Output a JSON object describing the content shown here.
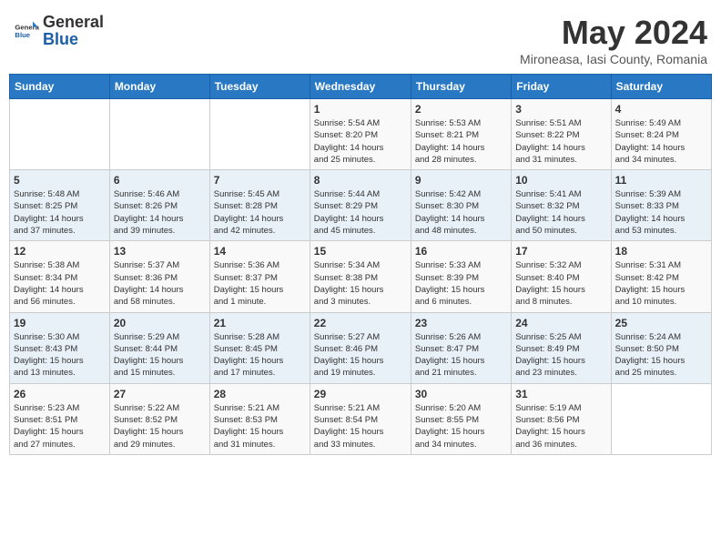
{
  "header": {
    "logo_general": "General",
    "logo_blue": "Blue",
    "month_title": "May 2024",
    "location": "Mironeasa, Iasi County, Romania"
  },
  "days_of_week": [
    "Sunday",
    "Monday",
    "Tuesday",
    "Wednesday",
    "Thursday",
    "Friday",
    "Saturday"
  ],
  "weeks": [
    [
      {
        "day": "",
        "info": ""
      },
      {
        "day": "",
        "info": ""
      },
      {
        "day": "",
        "info": ""
      },
      {
        "day": "1",
        "info": "Sunrise: 5:54 AM\nSunset: 8:20 PM\nDaylight: 14 hours\nand 25 minutes."
      },
      {
        "day": "2",
        "info": "Sunrise: 5:53 AM\nSunset: 8:21 PM\nDaylight: 14 hours\nand 28 minutes."
      },
      {
        "day": "3",
        "info": "Sunrise: 5:51 AM\nSunset: 8:22 PM\nDaylight: 14 hours\nand 31 minutes."
      },
      {
        "day": "4",
        "info": "Sunrise: 5:49 AM\nSunset: 8:24 PM\nDaylight: 14 hours\nand 34 minutes."
      }
    ],
    [
      {
        "day": "5",
        "info": "Sunrise: 5:48 AM\nSunset: 8:25 PM\nDaylight: 14 hours\nand 37 minutes."
      },
      {
        "day": "6",
        "info": "Sunrise: 5:46 AM\nSunset: 8:26 PM\nDaylight: 14 hours\nand 39 minutes."
      },
      {
        "day": "7",
        "info": "Sunrise: 5:45 AM\nSunset: 8:28 PM\nDaylight: 14 hours\nand 42 minutes."
      },
      {
        "day": "8",
        "info": "Sunrise: 5:44 AM\nSunset: 8:29 PM\nDaylight: 14 hours\nand 45 minutes."
      },
      {
        "day": "9",
        "info": "Sunrise: 5:42 AM\nSunset: 8:30 PM\nDaylight: 14 hours\nand 48 minutes."
      },
      {
        "day": "10",
        "info": "Sunrise: 5:41 AM\nSunset: 8:32 PM\nDaylight: 14 hours\nand 50 minutes."
      },
      {
        "day": "11",
        "info": "Sunrise: 5:39 AM\nSunset: 8:33 PM\nDaylight: 14 hours\nand 53 minutes."
      }
    ],
    [
      {
        "day": "12",
        "info": "Sunrise: 5:38 AM\nSunset: 8:34 PM\nDaylight: 14 hours\nand 56 minutes."
      },
      {
        "day": "13",
        "info": "Sunrise: 5:37 AM\nSunset: 8:36 PM\nDaylight: 14 hours\nand 58 minutes."
      },
      {
        "day": "14",
        "info": "Sunrise: 5:36 AM\nSunset: 8:37 PM\nDaylight: 15 hours\nand 1 minute."
      },
      {
        "day": "15",
        "info": "Sunrise: 5:34 AM\nSunset: 8:38 PM\nDaylight: 15 hours\nand 3 minutes."
      },
      {
        "day": "16",
        "info": "Sunrise: 5:33 AM\nSunset: 8:39 PM\nDaylight: 15 hours\nand 6 minutes."
      },
      {
        "day": "17",
        "info": "Sunrise: 5:32 AM\nSunset: 8:40 PM\nDaylight: 15 hours\nand 8 minutes."
      },
      {
        "day": "18",
        "info": "Sunrise: 5:31 AM\nSunset: 8:42 PM\nDaylight: 15 hours\nand 10 minutes."
      }
    ],
    [
      {
        "day": "19",
        "info": "Sunrise: 5:30 AM\nSunset: 8:43 PM\nDaylight: 15 hours\nand 13 minutes."
      },
      {
        "day": "20",
        "info": "Sunrise: 5:29 AM\nSunset: 8:44 PM\nDaylight: 15 hours\nand 15 minutes."
      },
      {
        "day": "21",
        "info": "Sunrise: 5:28 AM\nSunset: 8:45 PM\nDaylight: 15 hours\nand 17 minutes."
      },
      {
        "day": "22",
        "info": "Sunrise: 5:27 AM\nSunset: 8:46 PM\nDaylight: 15 hours\nand 19 minutes."
      },
      {
        "day": "23",
        "info": "Sunrise: 5:26 AM\nSunset: 8:47 PM\nDaylight: 15 hours\nand 21 minutes."
      },
      {
        "day": "24",
        "info": "Sunrise: 5:25 AM\nSunset: 8:49 PM\nDaylight: 15 hours\nand 23 minutes."
      },
      {
        "day": "25",
        "info": "Sunrise: 5:24 AM\nSunset: 8:50 PM\nDaylight: 15 hours\nand 25 minutes."
      }
    ],
    [
      {
        "day": "26",
        "info": "Sunrise: 5:23 AM\nSunset: 8:51 PM\nDaylight: 15 hours\nand 27 minutes."
      },
      {
        "day": "27",
        "info": "Sunrise: 5:22 AM\nSunset: 8:52 PM\nDaylight: 15 hours\nand 29 minutes."
      },
      {
        "day": "28",
        "info": "Sunrise: 5:21 AM\nSunset: 8:53 PM\nDaylight: 15 hours\nand 31 minutes."
      },
      {
        "day": "29",
        "info": "Sunrise: 5:21 AM\nSunset: 8:54 PM\nDaylight: 15 hours\nand 33 minutes."
      },
      {
        "day": "30",
        "info": "Sunrise: 5:20 AM\nSunset: 8:55 PM\nDaylight: 15 hours\nand 34 minutes."
      },
      {
        "day": "31",
        "info": "Sunrise: 5:19 AM\nSunset: 8:56 PM\nDaylight: 15 hours\nand 36 minutes."
      },
      {
        "day": "",
        "info": ""
      }
    ]
  ]
}
